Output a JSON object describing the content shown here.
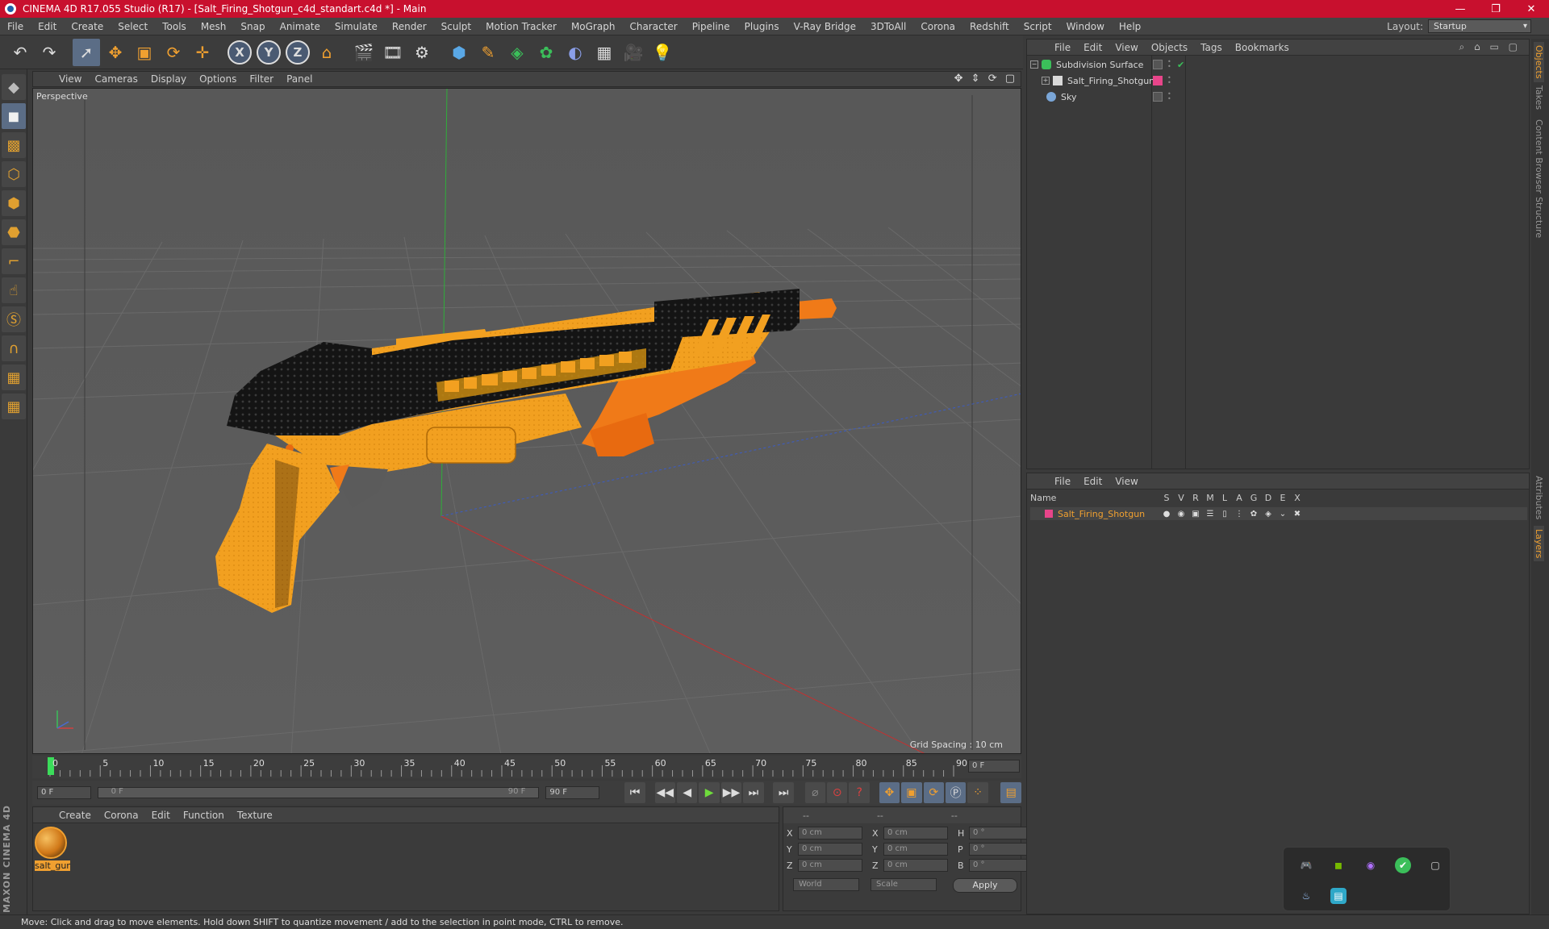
{
  "window": {
    "title": "CINEMA 4D R17.055 Studio (R17) - [Salt_Firing_Shotgun_c4d_standart.c4d *] - Main",
    "min": "—",
    "max": "❐",
    "close": "✕"
  },
  "menu": {
    "items": [
      "File",
      "Edit",
      "Create",
      "Select",
      "Tools",
      "Mesh",
      "Snap",
      "Animate",
      "Simulate",
      "Render",
      "Sculpt",
      "Motion Tracker",
      "MoGraph",
      "Character",
      "Pipeline",
      "Plugins",
      "V-Ray Bridge",
      "3DToAll",
      "Corona",
      "Redshift",
      "Script",
      "Window",
      "Help"
    ],
    "layout_label": "Layout:",
    "layout_value": "Startup"
  },
  "toolbar": {
    "undo": "↶",
    "redo": "↷",
    "live_select": "➚",
    "move": "✥",
    "scale": "▣",
    "rotate": "⟳",
    "last_tool": "✛",
    "x_axis": "X",
    "y_axis": "Y",
    "z_axis": "Z",
    "coord_system": "⌂",
    "render_view": "🎬",
    "render_picture": "🎞",
    "render_settings": "⚙",
    "cube": "⬢",
    "pen": "✎",
    "subdivision": "◈",
    "cloner": "✿",
    "deformer": "◐",
    "floor": "▦",
    "camera": "🎥",
    "light": "💡"
  },
  "left_palette": {
    "icons": [
      "◆",
      "◼",
      "▩",
      "⬡",
      "⬢",
      "⬣",
      "⌐",
      "☝",
      "Ⓢ",
      "∩",
      "▦",
      "▦"
    ],
    "brand": "MAXON CINEMA 4D"
  },
  "viewport": {
    "menu": [
      "View",
      "Cameras",
      "Display",
      "Options",
      "Filter",
      "Panel"
    ],
    "nav_icons": "✥ ⇕ ⟳ ▢",
    "label": "Perspective",
    "grid_spacing": "Grid Spacing : 10 cm"
  },
  "timeline": {
    "ticks": [
      "0",
      "5",
      "10",
      "15",
      "20",
      "25",
      "30",
      "35",
      "40",
      "45",
      "50",
      "55",
      "60",
      "65",
      "70",
      "75",
      "80",
      "85",
      "90"
    ],
    "current_frame": "0 F"
  },
  "transport": {
    "start_field": "0 F",
    "range_start": "0 F",
    "range_end": "90 F",
    "end_field": "90 F",
    "buttons": [
      "⏮",
      "◀◀",
      "◀",
      "▶",
      "▶▶",
      "⏭",
      "⏭"
    ]
  },
  "material_manager": {
    "menu": [
      "Create",
      "Corona",
      "Edit",
      "Function",
      "Texture"
    ],
    "material_name": "salt_gun"
  },
  "coordinates": {
    "headers": [
      "--",
      "--",
      "--"
    ],
    "rows": [
      {
        "a_label": "X",
        "a_value": "0 cm",
        "b_label": "X",
        "b_value": "0 cm",
        "c_label": "H",
        "c_value": "0 °"
      },
      {
        "a_label": "Y",
        "a_value": "0 cm",
        "b_label": "Y",
        "b_value": "0 cm",
        "c_label": "P",
        "c_value": "0 °"
      },
      {
        "a_label": "Z",
        "a_value": "0 cm",
        "b_label": "Z",
        "b_value": "0 cm",
        "c_label": "B",
        "c_value": "0 °"
      }
    ],
    "mode_world": "World",
    "mode_scale": "Scale",
    "apply": "Apply"
  },
  "object_manager": {
    "menu": [
      "File",
      "Edit",
      "View",
      "Objects",
      "Tags",
      "Bookmarks"
    ],
    "objects": [
      {
        "name": "Subdivision Surface",
        "color": "#3bbf5a"
      },
      {
        "name": "Salt_Firing_Shotgun",
        "color": "#d9d9d9"
      },
      {
        "name": "Sky",
        "color": "#7aa6d8"
      }
    ]
  },
  "layer_manager": {
    "menu": [
      "File",
      "Edit",
      "View"
    ],
    "columns": [
      "Name",
      "S",
      "V",
      "R",
      "M",
      "L",
      "A",
      "G",
      "D",
      "E",
      "X"
    ],
    "layer_name": "Salt_Firing_Shotgun",
    "layer_color": "#e8458a"
  },
  "right_tabs": [
    "Objects",
    "Takes",
    "Content Browser",
    "Structure",
    "Attributes",
    "Layers"
  ],
  "statusbar": {
    "text": "Move: Click and drag to move elements. Hold down SHIFT to quantize movement / add to the selection in point mode, CTRL to remove."
  },
  "tray": {
    "icons": [
      "🎮",
      "◼",
      "◉",
      "✔",
      "▢",
      "♨",
      "▤"
    ]
  },
  "colors": {
    "accent": "#f0a030",
    "titlebar": "#c8102e",
    "active_tool": "#5b6d86"
  }
}
